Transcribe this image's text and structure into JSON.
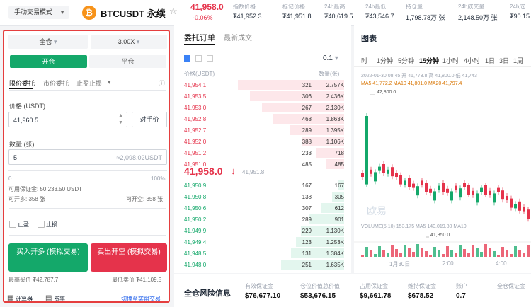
{
  "header": {
    "mode_label": "手动交易模式",
    "coin_symbol": "₿",
    "pair": "BTCUSDT 永续",
    "last_price": "41,958.0",
    "change_pct": "-0.06%",
    "stats": [
      {
        "label": "指数价格",
        "value": "₮41,952.3"
      },
      {
        "label": "标记价格",
        "value": "₮41,951.8"
      },
      {
        "label": "24h最高",
        "value": "₮40,619.5"
      },
      {
        "label": "24h最低",
        "value": "₮43,546.7"
      },
      {
        "label": "持仓量",
        "value": "1,798.78万 张"
      },
      {
        "label": "24h成交量",
        "value": "2,148.50万 张"
      },
      {
        "label": "24h成",
        "value": "₮90.15"
      }
    ]
  },
  "order_panel": {
    "margin_mode": "全仓",
    "leverage": "3.00X",
    "tab_open": "开仓",
    "tab_close": "平仓",
    "order_types": [
      "限价委托",
      "市价委托",
      "止盈止损"
    ],
    "price_label": "价格 (USDT)",
    "price_value": "41,960.5",
    "counter_price_btn": "对手价",
    "qty_label": "数量 (张)",
    "qty_value": "5",
    "qty_equiv": "≈2,098.02USDT",
    "slider_min": "0",
    "slider_max": "100%",
    "available_label": "可用保证金: 50,233.50 USDT",
    "can_open_long": "可开多: 358 张",
    "can_open_short": "可开空: 358 张",
    "take_profit": "止盈",
    "stop_loss": "止损",
    "buy_btn": "买入开多 (模拟交易)",
    "sell_btn": "卖出开空 (模拟交易)",
    "liq_long": "最高买价 ₮42,787.7",
    "liq_short": "最低卖价 ₮41,109.5",
    "calculator": "计算器",
    "rates": "费率",
    "switch_real": "切换至实盘交易"
  },
  "orderbook": {
    "tab_active": "委托订单",
    "tab_other": "最新成交",
    "precision": "0.1",
    "col_price": "价格(USDT)",
    "col_qty": "数量(张)",
    "asks": [
      {
        "price": "41,954.1",
        "qty": "321",
        "total": "2.757K"
      },
      {
        "price": "41,953.5",
        "qty": "306",
        "total": "2.436K"
      },
      {
        "price": "41,953.0",
        "qty": "267",
        "total": "2.130K"
      },
      {
        "price": "41,952.8",
        "qty": "468",
        "total": "1.863K"
      },
      {
        "price": "41,952.7",
        "qty": "289",
        "total": "1.395K"
      },
      {
        "price": "41,952.0",
        "qty": "388",
        "total": "1.106K"
      },
      {
        "price": "41,951.2",
        "qty": "233",
        "total": "718"
      },
      {
        "price": "41,951.0",
        "qty": "485",
        "total": "485"
      }
    ],
    "mid_price": "41,958.0",
    "mid_arrow": "↓",
    "mid_mark": "41,951.8",
    "bids": [
      {
        "price": "41,950.9",
        "qty": "167",
        "total": "167"
      },
      {
        "price": "41,950.8",
        "qty": "138",
        "total": "305"
      },
      {
        "price": "41,950.6",
        "qty": "307",
        "total": "612"
      },
      {
        "price": "41,950.2",
        "qty": "289",
        "total": "901"
      },
      {
        "price": "41,949.9",
        "qty": "229",
        "total": "1.130K"
      },
      {
        "price": "41,949.4",
        "qty": "123",
        "total": "1.253K"
      },
      {
        "price": "41,948.5",
        "qty": "131",
        "total": "1.384K"
      },
      {
        "price": "41,948.0",
        "qty": "251",
        "total": "1.635K"
      }
    ]
  },
  "chart": {
    "title": "图表",
    "timeframes": [
      "时",
      "1分钟",
      "5分钟",
      "15分钟",
      "1小时",
      "4小时",
      "1日",
      "3日",
      "1周"
    ],
    "active_tf": "15分钟",
    "ohlc_line": "2022-01-30 08:45  开 41,773.8  高 41,800.0  低 41,743",
    "ma_line": "MA5 41,772.2  MA10 41,801.0  MA20 41,797.4",
    "high_mark": "42,800.0",
    "low_mark": "41,350.0",
    "watermark": "欧易",
    "volume_line": "VOLUME(5,10)  153,175  MA5 140,019.80  MA10",
    "x_ticks": [
      "1月30日",
      "2:00",
      "4:00"
    ]
  },
  "bottom_info": {
    "title": "全仓风险信息",
    "items": [
      {
        "label": "有效保证金",
        "value": "$76,677.10"
      },
      {
        "label": "仓位价值总价值",
        "value": "$53,676.15"
      },
      {
        "label": "占用保证金",
        "value": "$9,661.78"
      },
      {
        "label": "维持保证金",
        "value": "$678.52"
      },
      {
        "label": "账户",
        "value": "0.7"
      },
      {
        "label": "全仓保证金",
        "value": ""
      }
    ]
  }
}
